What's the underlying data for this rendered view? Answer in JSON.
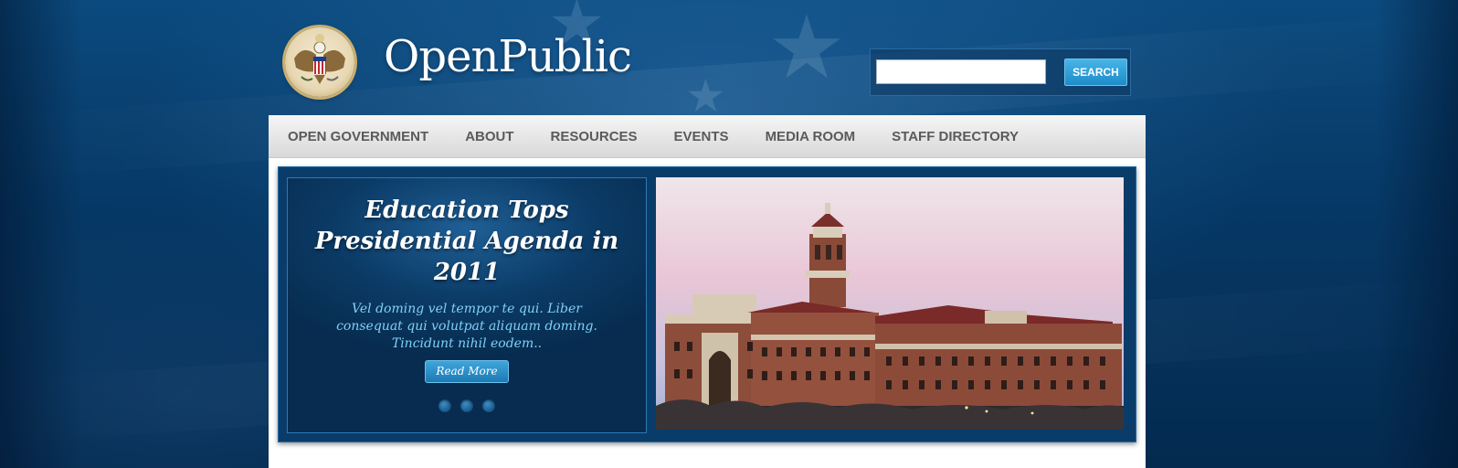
{
  "header": {
    "site_title": "OpenPublic",
    "logo_icon": "great-seal",
    "search": {
      "input_value": "",
      "placeholder": "",
      "button_label": "SEARCH"
    }
  },
  "nav": {
    "items": [
      {
        "label": "OPEN GOVERNMENT"
      },
      {
        "label": "ABOUT"
      },
      {
        "label": "RESOURCES"
      },
      {
        "label": "EVENTS"
      },
      {
        "label": "MEDIA ROOM"
      },
      {
        "label": "STAFF DIRECTORY"
      }
    ]
  },
  "slideshow": {
    "title": "Education Tops Presidential Agenda in 2011",
    "teaser": "Vel doming vel tempor te qui. Liber consequat qui volutpat aliquam doming. Tincidunt nihil eodem..",
    "read_more_label": "Read More",
    "dots_count": 3,
    "image_subject": "university building with clock tower at dusk"
  },
  "colors": {
    "background": "#063865",
    "accent_button": "#1d8cc9",
    "nav_text": "#5a5a5a",
    "caption_text": "#7fd0f5",
    "slider_bg": "#0a3c6a"
  }
}
